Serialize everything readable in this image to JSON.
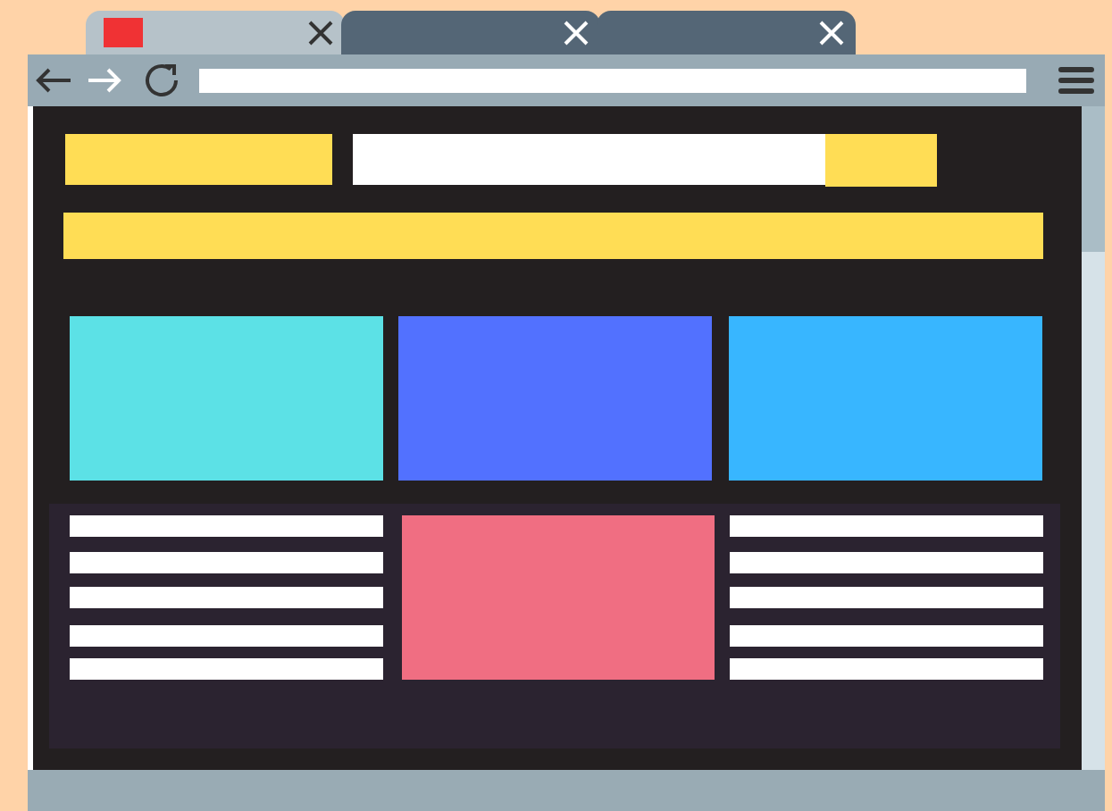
{
  "tabs": [
    {
      "selected": true,
      "favicon": true
    },
    {
      "selected": false,
      "favicon": false
    },
    {
      "selected": false,
      "favicon": false
    }
  ],
  "hero_cards": [
    {
      "color": "#5ce1e6"
    },
    {
      "color": "#5271ff"
    },
    {
      "color": "#38b6ff"
    }
  ]
}
